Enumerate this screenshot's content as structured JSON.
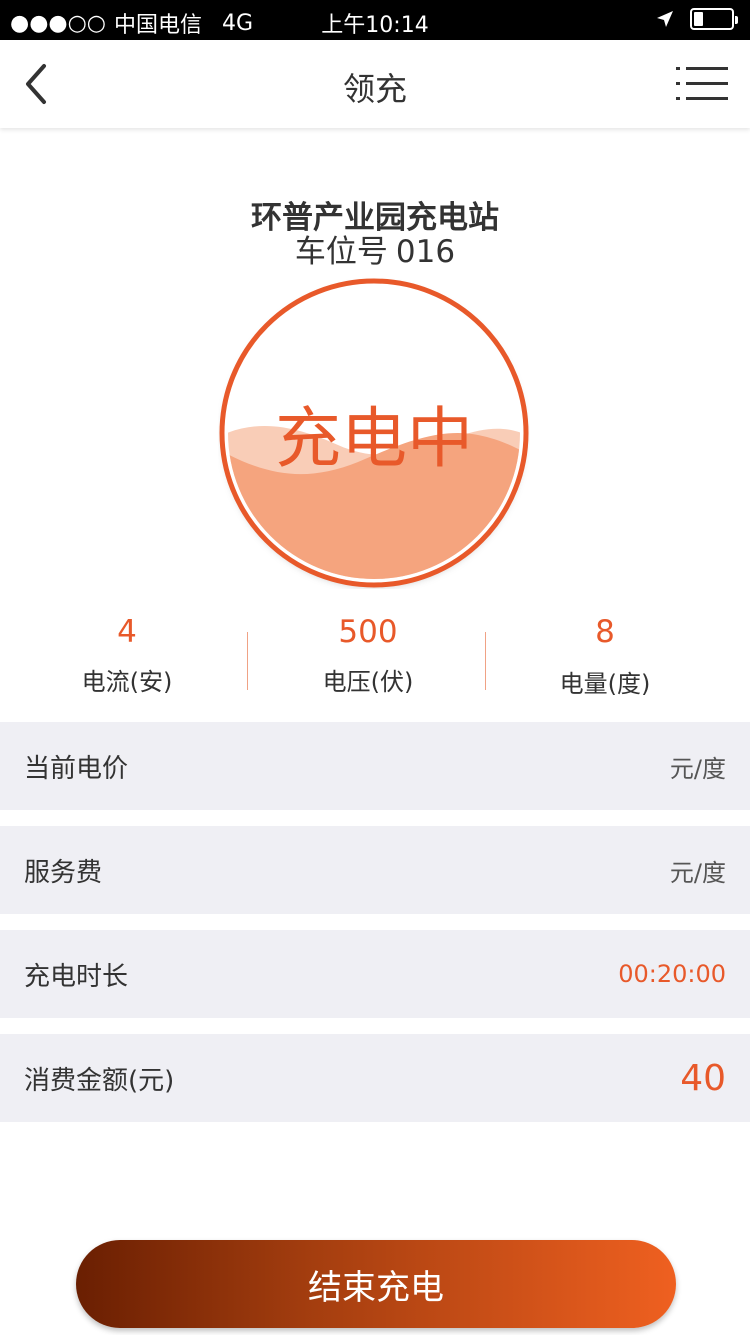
{
  "status_bar": {
    "signal": "●●●○○",
    "carrier": "中国电信",
    "network": "4G",
    "time": "上午10:14",
    "battery_level": 0.25
  },
  "nav": {
    "title": "领充",
    "back_icon": "chevron-left-icon",
    "menu_icon": "list-menu-icon"
  },
  "station": {
    "name": "环普产业园充电站",
    "spot_label": "车位号",
    "spot_number": "016"
  },
  "gauge": {
    "status_text": "充电中",
    "accent_color": "#e8592a",
    "fill_color": "#f5a47e"
  },
  "stats": [
    {
      "value": "4",
      "label": "电流(安)"
    },
    {
      "value": "500",
      "label": "电压(伏)"
    },
    {
      "value": "8",
      "label": "电量(度)"
    }
  ],
  "info_rows": [
    {
      "label": "当前电价",
      "value": "元/度"
    },
    {
      "label": "服务费",
      "value": "元/度"
    },
    {
      "label": "充电时长",
      "value": "00:20:00"
    },
    {
      "label": "消费金额(元)",
      "value": "40"
    }
  ],
  "end_button": {
    "label": "结束充电"
  }
}
